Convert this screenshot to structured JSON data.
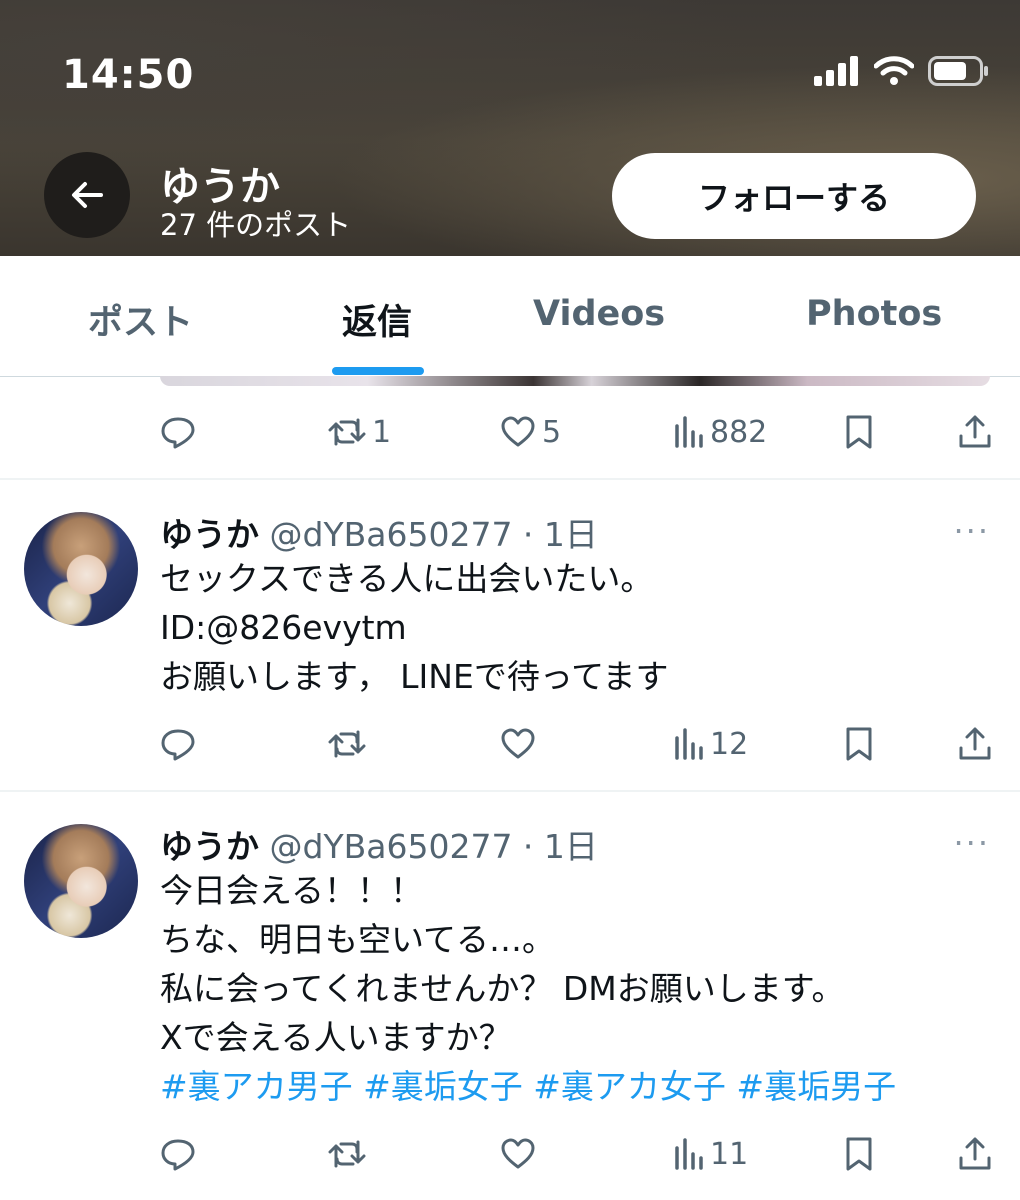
{
  "status_bar": {
    "time": "14:50"
  },
  "profile": {
    "name": "ゆうか",
    "post_count": "27 件のポスト",
    "follow_label": "フォローする"
  },
  "tabs": [
    {
      "label": "ポスト"
    },
    {
      "label": "返信"
    },
    {
      "label": "Videos"
    },
    {
      "label": "Photos"
    }
  ],
  "active_tab": "返信",
  "colors": {
    "accent": "#1d9bf0",
    "text": "#0f1419",
    "muted": "#536471"
  },
  "prev_tweet_actions": {
    "replies": "",
    "reposts": "1",
    "likes": "5",
    "views": "882"
  },
  "tweets": [
    {
      "name": "ゆうか",
      "meta": "@dYBa650277 · 1日",
      "lines": [
        "セックスできる人に出会いたい。",
        "ID:@826evytm",
        "お願いします，  LINEで待ってます"
      ],
      "actions": {
        "replies": "",
        "reposts": "",
        "likes": "",
        "views": "12"
      }
    },
    {
      "name": "ゆうか",
      "meta": "@dYBa650277 · 1日",
      "lines": [
        "今日会える！！！",
        "ちな、明日も空いてる…。",
        "私に会ってくれませんか？  DMお願いします。",
        "Xで会える人いますか？"
      ],
      "hashtags": "#裏アカ男子 #裏垢女子 #裏アカ女子 #裏垢男子",
      "actions": {
        "replies": "",
        "reposts": "",
        "likes": "",
        "views": "11"
      }
    }
  ],
  "more_icon": "···"
}
